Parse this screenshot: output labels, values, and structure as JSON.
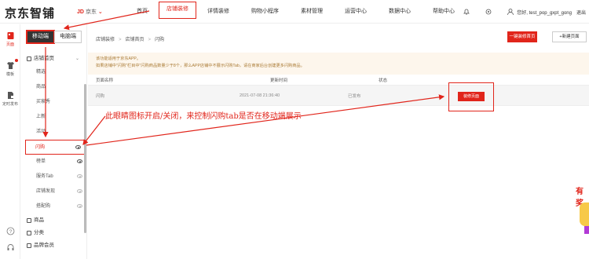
{
  "header": {
    "logo": "京东智铺",
    "jd_badge": "JD",
    "jd_sub": "京东",
    "nav": [
      "首页",
      "店铺装修",
      "详情装修",
      "购物小程序",
      "素材管理",
      "运营中心",
      "数据中心",
      "帮助中心"
    ],
    "active_nav_index": 1,
    "user_text": "您好, test_pop_gxpt_gong",
    "logout": "退出"
  },
  "rail": {
    "items": [
      {
        "label": "页面",
        "icon": "page-icon"
      },
      {
        "label": "模板",
        "icon": "shirt-icon"
      },
      {
        "label": "定时发布",
        "icon": "doc-icon"
      }
    ],
    "bottom_icons": [
      "help-icon",
      "headset-icon"
    ]
  },
  "panel": {
    "tabs": [
      "移动端",
      "电脑端"
    ],
    "groups": [
      {
        "label": "店铺首页"
      }
    ],
    "items": [
      {
        "label": "精选",
        "eye": "none"
      },
      {
        "label": "商品",
        "eye": "none"
      },
      {
        "label": "买家秀",
        "eye": "none"
      },
      {
        "label": "上新",
        "eye": "none"
      },
      {
        "label": "活动",
        "eye": "none"
      },
      {
        "label": "闪购",
        "eye": "on",
        "selected": true
      },
      {
        "label": "榜单",
        "eye": "on"
      },
      {
        "label": "服务Tab",
        "eye": "off"
      },
      {
        "label": "店铺发现",
        "eye": "off"
      },
      {
        "label": "搭配购",
        "eye": "off"
      }
    ],
    "bottom_groups": [
      {
        "label": "商品"
      },
      {
        "label": "分类"
      },
      {
        "label": "品牌会员"
      }
    ]
  },
  "main": {
    "breadcrumb": [
      "店铺装修",
      "店铺首页",
      "闪购"
    ],
    "btn_publish": "一键装修首页",
    "btn_new": "+新建页面",
    "notice_line1": "该功能适用于京东APP。",
    "notice_line2": "如果店铺中\"闪购\"栏目中\"闪购商品数量少于8个，那么APP店铺中不展示闪购Tab，请在商家后台创建更多闪购商品。",
    "columns": [
      "页面名称",
      "更新时间",
      "状态"
    ],
    "rows": [
      {
        "name": "闪购",
        "time": "2021-07-08 21:36:40",
        "status": "已发布"
      }
    ],
    "decorate_btn": "装修页面"
  },
  "annotation": "此眼睛图标开启/关闭，来控制闪购tab是否在移动端展示",
  "promo_text": "有 奖"
}
